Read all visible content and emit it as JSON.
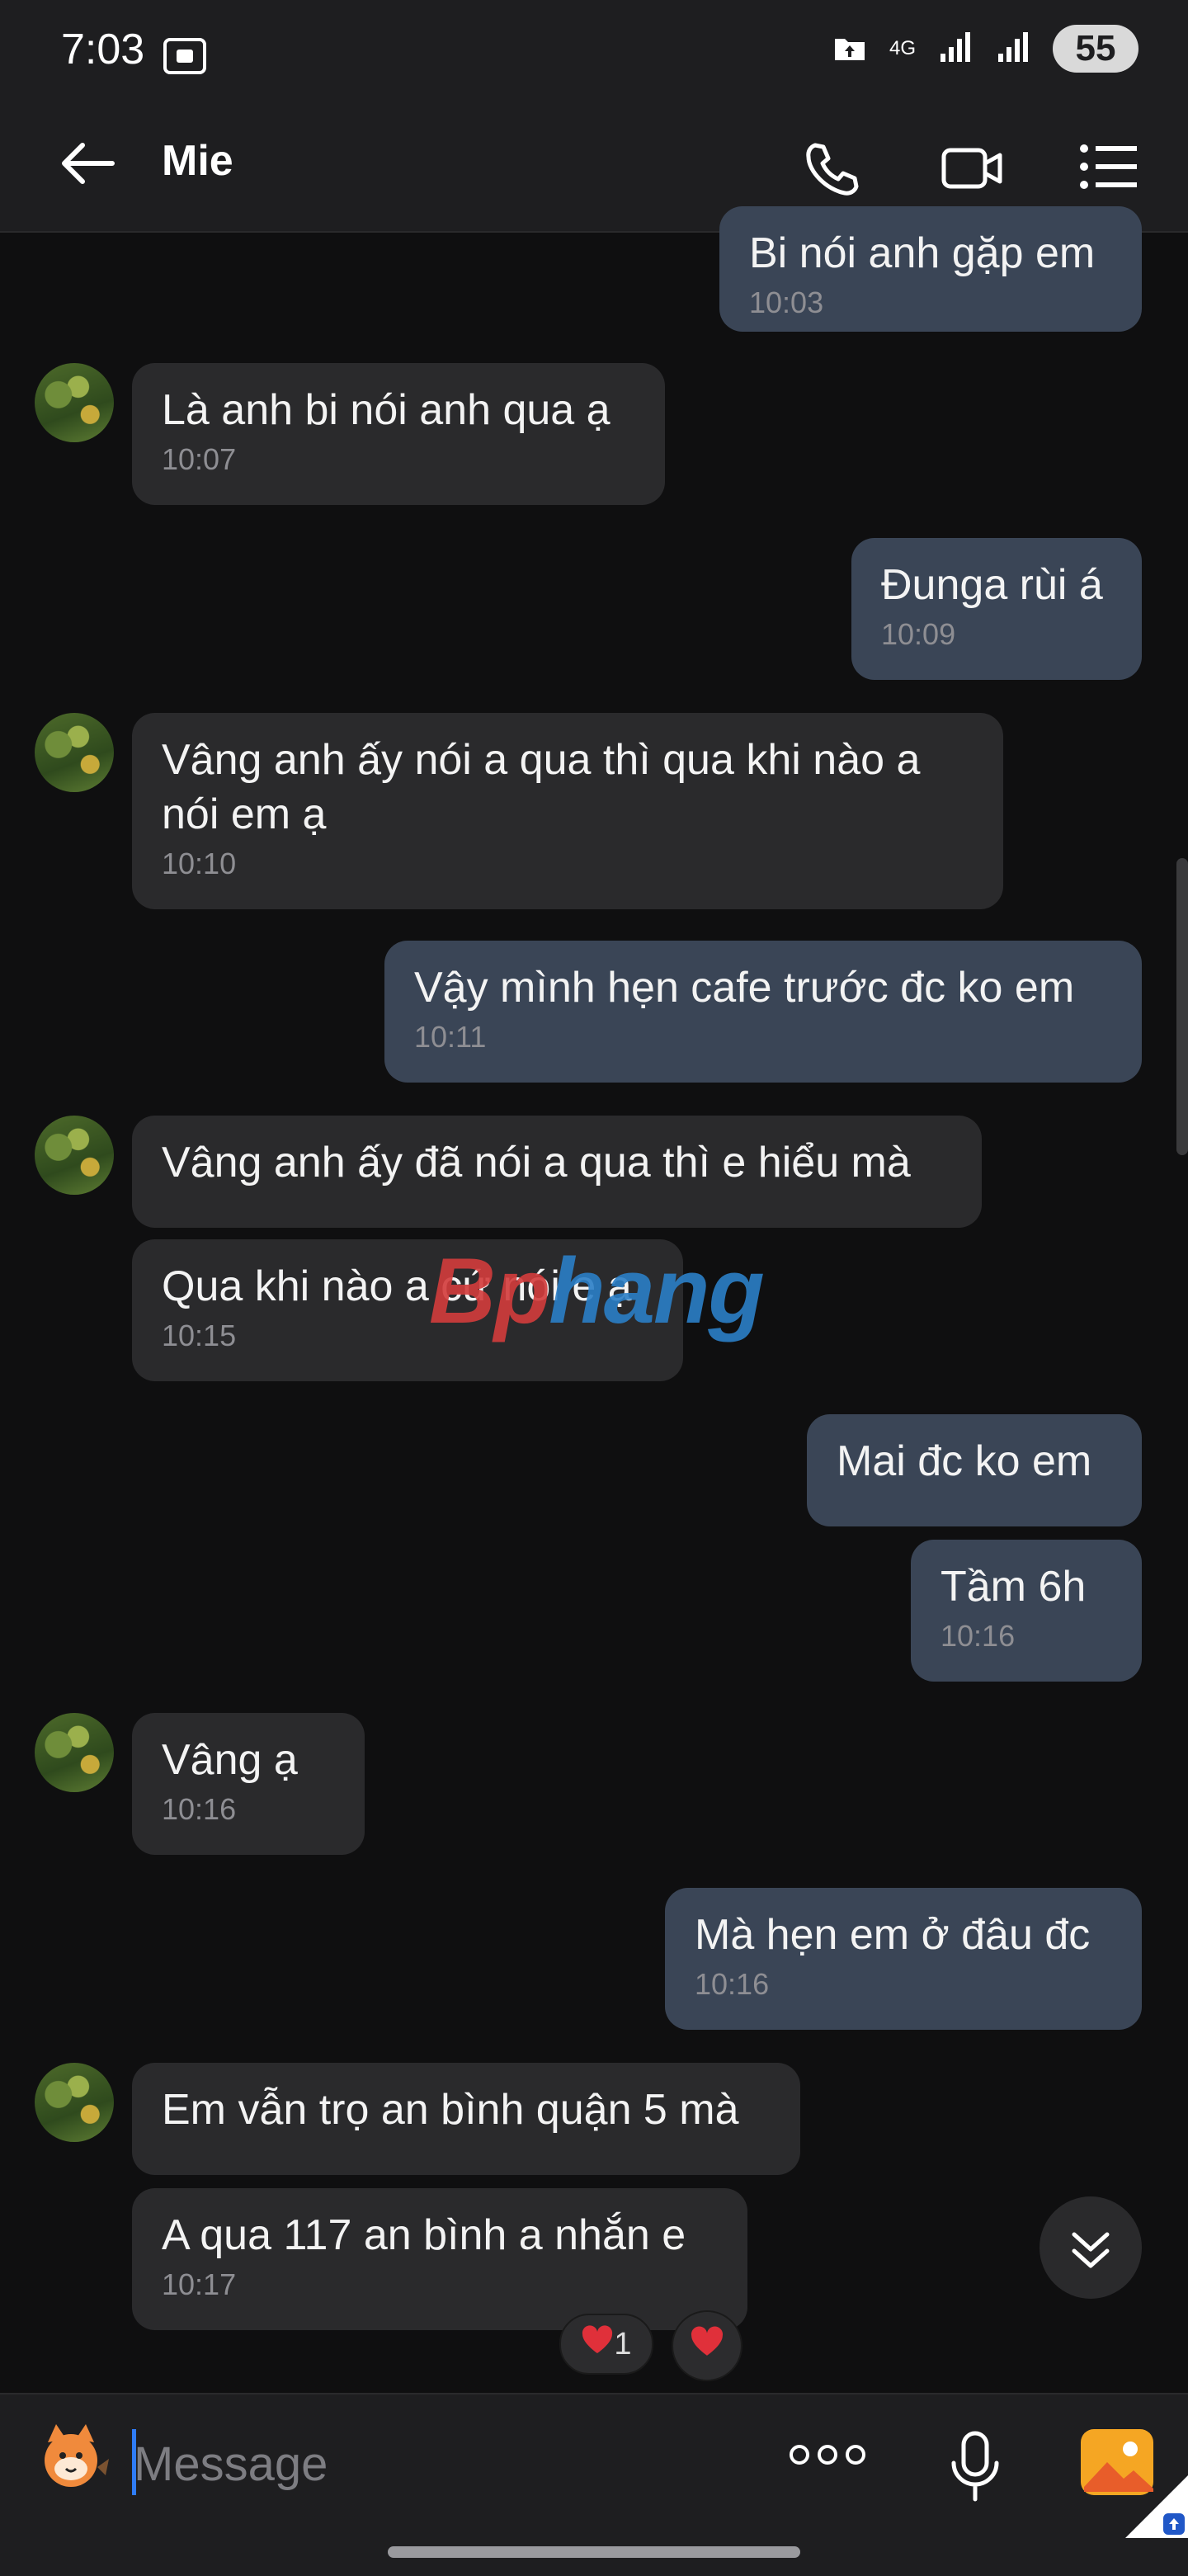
{
  "status_bar": {
    "time": "7:03",
    "network_label": "4G",
    "battery": "55"
  },
  "header": {
    "contact_name": "Mie"
  },
  "messages": [
    {
      "dir": "out",
      "text": "Bi nói anh gặp em",
      "time": "10:03"
    },
    {
      "dir": "in",
      "text": "Là anh bi nói anh qua ạ",
      "time": "10:07"
    },
    {
      "dir": "out",
      "text": "Đunga rùi á",
      "time": "10:09"
    },
    {
      "dir": "in",
      "text": "Vâng anh ấy nói a qua thì qua khi nào a\nnói em ạ",
      "time": "10:10"
    },
    {
      "dir": "out",
      "text": "Vậy mình hẹn cafe trước đc ko em",
      "time": "10:11"
    },
    {
      "dir": "in",
      "text": "Vâng anh ấy đã nói a qua thì e hiểu mà",
      "time": ""
    },
    {
      "dir": "in",
      "text": "Qua khi nào a cứ nói e ạ",
      "time": "10:15"
    },
    {
      "dir": "out",
      "text": "Mai đc ko em",
      "time": ""
    },
    {
      "dir": "out",
      "text": "Tầm 6h",
      "time": "10:16"
    },
    {
      "dir": "in",
      "text": "Vâng ạ",
      "time": "10:16"
    },
    {
      "dir": "out",
      "text": "Mà hẹn em ở đâu đc",
      "time": "10:16"
    },
    {
      "dir": "in",
      "text": "Em vẫn trọ an bình quận 5 mà",
      "time": ""
    },
    {
      "dir": "in",
      "text": "A qua 117 an bình a nhắn e",
      "time": "10:17"
    }
  ],
  "reactions": {
    "heart_count": "1"
  },
  "watermark": {
    "part1": "Bp",
    "part2": "hang"
  },
  "composer": {
    "placeholder": "Message"
  },
  "colors": {
    "incoming_bubble": "#2a2a2c",
    "outgoing_bubble": "#3a4556",
    "accent": "#2f7cf6"
  }
}
